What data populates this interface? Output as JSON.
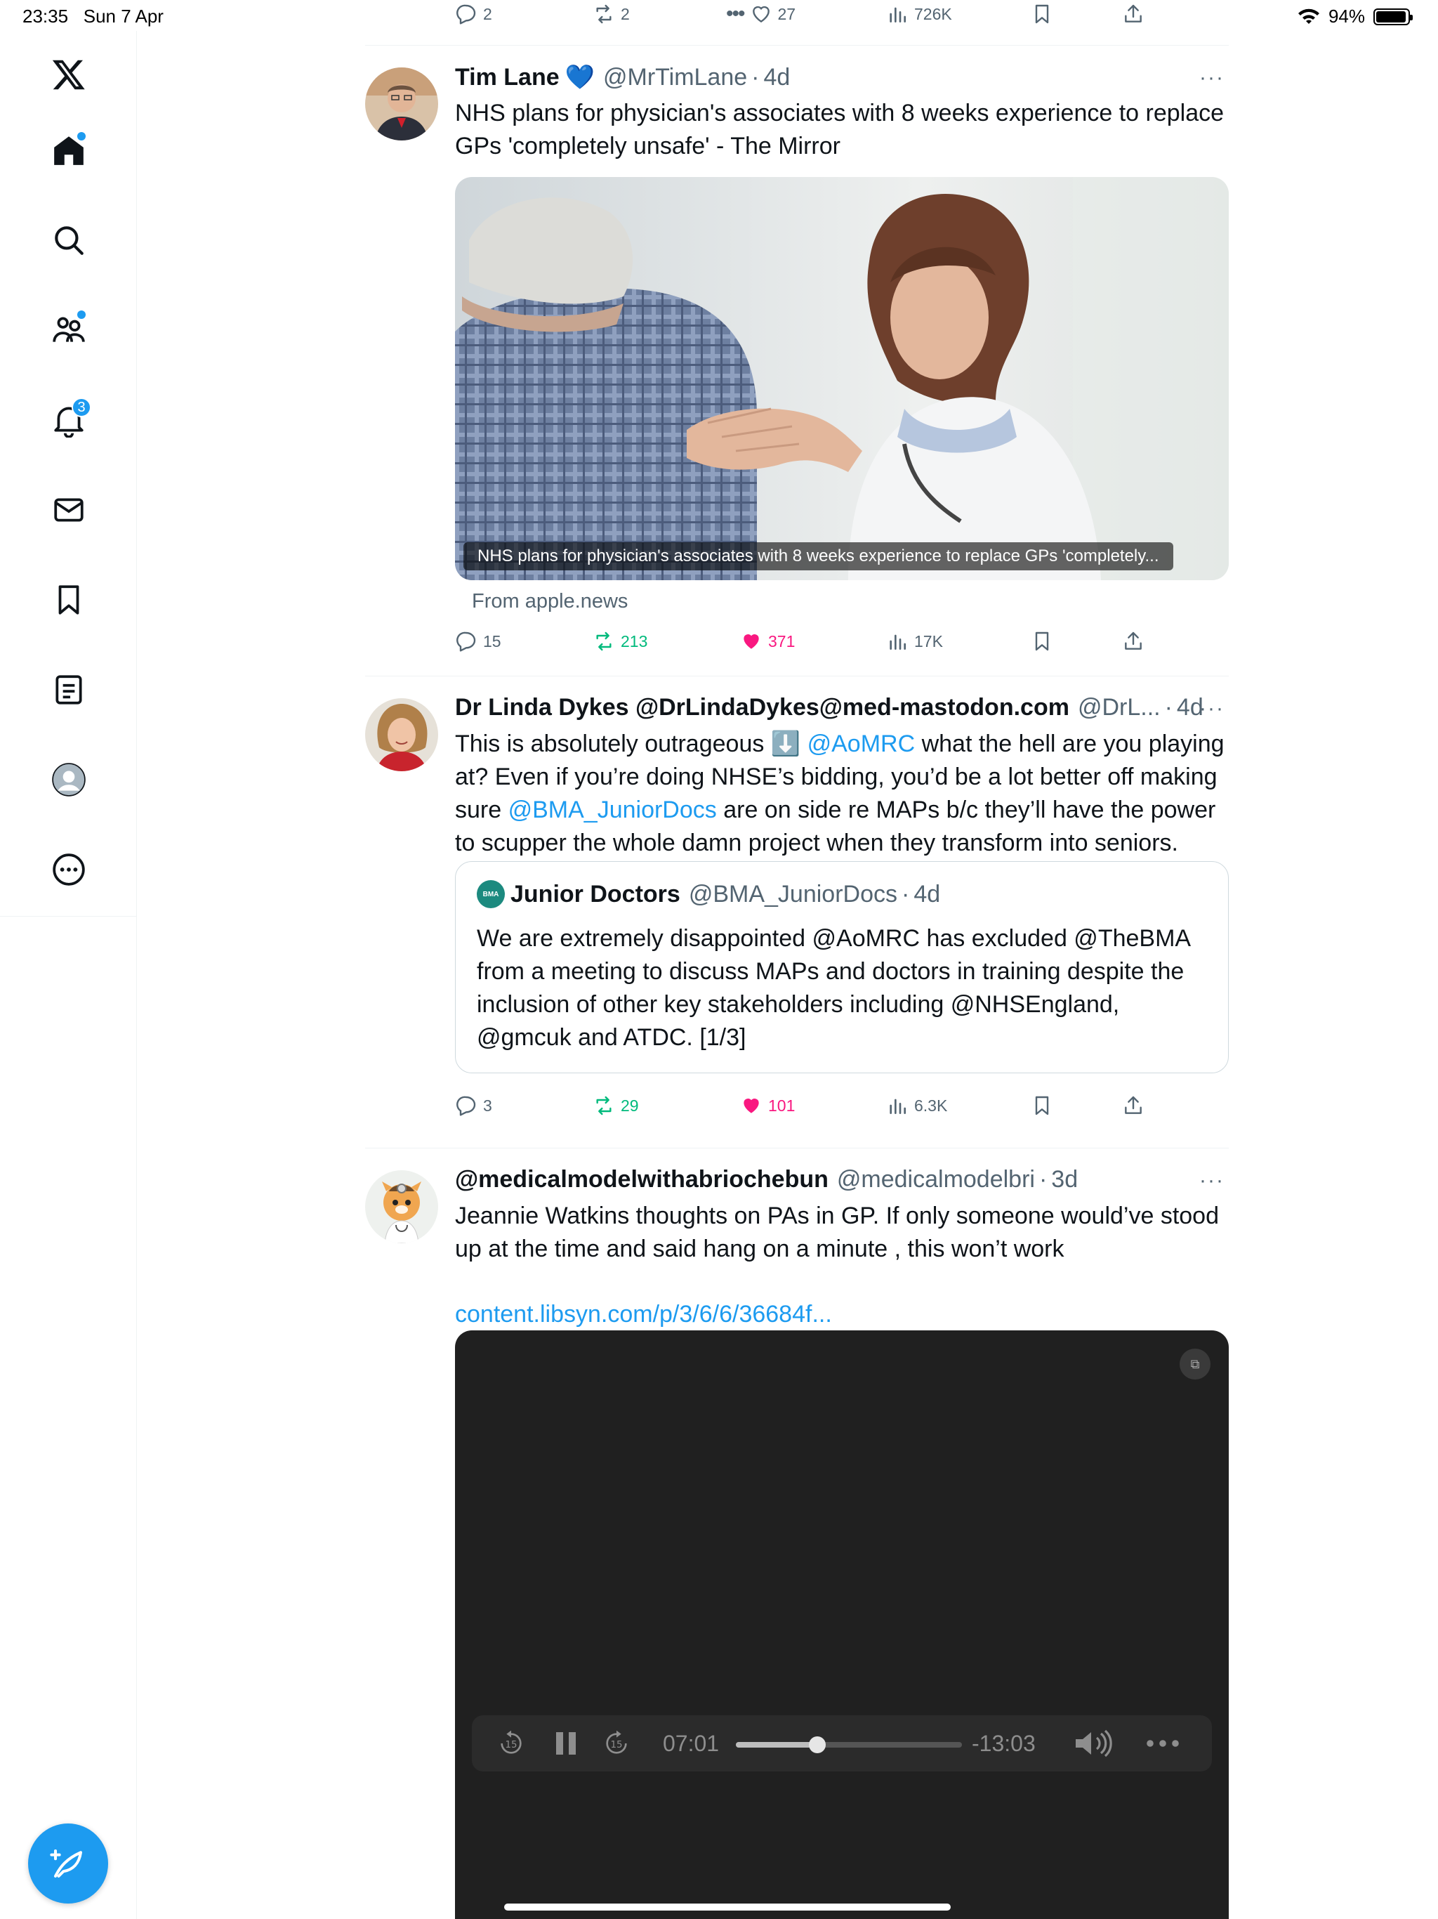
{
  "status": {
    "time": "23:35",
    "date": "Sun 7 Apr",
    "battery": "94%"
  },
  "sidebar": {
    "items": [
      {
        "name": "x-logo-icon"
      },
      {
        "name": "home-icon",
        "has_dot": true
      },
      {
        "name": "search-icon"
      },
      {
        "name": "communities-icon",
        "has_dot": true
      },
      {
        "name": "notifications-icon",
        "badge": "3"
      },
      {
        "name": "messages-icon"
      },
      {
        "name": "bookmarks-icon"
      },
      {
        "name": "lists-icon"
      },
      {
        "name": "profile-icon"
      },
      {
        "name": "more-icon"
      }
    ],
    "compose_icon": "compose-feather-icon"
  },
  "top_actions": {
    "replies": "2",
    "reposts": "2",
    "likes": "27",
    "views": "726K"
  },
  "tweets": [
    {
      "name": "Tim Lane",
      "verified_emoji": "💙",
      "handle": "@MrTimLane",
      "sep": "·",
      "time": "4d",
      "text": "NHS plans for physician's associates with 8 weeks experience to replace GPs 'completely unsafe' - The Mirror",
      "card_caption": "NHS plans for physician's associates with 8 weeks experience to replace GPs 'completely...",
      "card_source": "From apple.news",
      "actions": {
        "replies": "15",
        "reposts": "213",
        "likes": "371",
        "views": "17K"
      }
    },
    {
      "name": "Dr Linda Dykes @DrLindaDykes@med-mastodon.com",
      "handle": "@DrL...",
      "sep": "·",
      "time": "4d",
      "text_parts": {
        "a": "This is absolutely outrageous ",
        "emoji": "⬇️",
        "m1": "@AoMRC",
        "b": " what the hell are you playing at? Even if you’re doing NHSE’s bidding, you’d be a lot better off making sure ",
        "m2": "@BMA_JuniorDocs",
        "c": " are on side re MAPs b/c they’ll have the power to scupper the whole damn project when they transform into seniors."
      },
      "quote": {
        "logo_text": "BMA",
        "name": "Junior Doctors",
        "handle": "@BMA_JuniorDocs",
        "sep": "·",
        "time": "4d",
        "text": "We are extremely disappointed @AoMRC has excluded @TheBMA from a meeting to discuss MAPs and doctors in training despite the inclusion of other key stakeholders including @NHSEngland, @gmcuk and ATDC. [1/3]"
      },
      "actions": {
        "replies": "3",
        "reposts": "29",
        "likes": "101",
        "views": "6.3K"
      }
    },
    {
      "name": "@medicalmodelwithabriochebun",
      "handle": "@medicalmodelbri",
      "sep": "·",
      "time": "3d",
      "text": "Jeannie Watkins thoughts on PAs in GP. If only someone would’ve stood up at the time and said hang on a minute , this won’t work",
      "link": "content.libsyn.com/p/3/6/6/36684f...",
      "player": {
        "elapsed": "07:01",
        "remaining": "-13:03",
        "progress": 0.36,
        "skip_back": "15",
        "skip_fwd": "15"
      }
    }
  ],
  "colors": {
    "accent": "#1d9bf0",
    "like": "#f91880",
    "repost": "#00ba7c",
    "muted": "#536471"
  }
}
